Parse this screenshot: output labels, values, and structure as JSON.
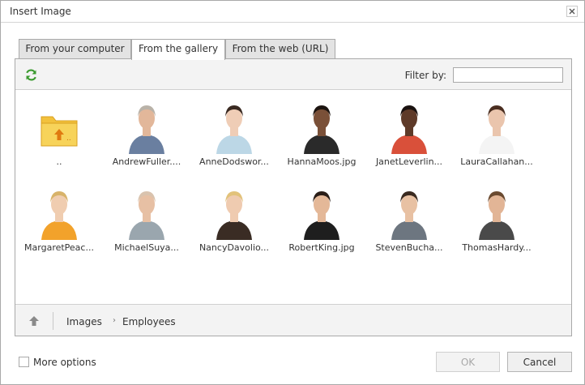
{
  "dialog": {
    "title": "Insert Image",
    "close_icon": "close-icon"
  },
  "tabs": [
    {
      "label": "From your computer",
      "active": false
    },
    {
      "label": "From the gallery",
      "active": true
    },
    {
      "label": "From the web (URL)",
      "active": false
    }
  ],
  "toolbar": {
    "refresh_icon": "refresh-icon",
    "filter_label": "Filter by:",
    "filter_value": ""
  },
  "gallery": {
    "items": [
      {
        "name": "..",
        "type": "folder-up"
      },
      {
        "name": "AndrewFuller....",
        "type": "image",
        "shirt": "#6a7fa0",
        "skin": "#e2b79a",
        "hair": "#b9b2a8"
      },
      {
        "name": "AnneDodswor...",
        "type": "image",
        "shirt": "#bcd7e6",
        "skin": "#efcdb6",
        "hair": "#3a2a22"
      },
      {
        "name": "HannaMoos.jpg",
        "type": "image",
        "shirt": "#2a2a2a",
        "skin": "#7a5038",
        "hair": "#1c1410"
      },
      {
        "name": "JanetLeverlin...",
        "type": "image",
        "shirt": "#d9503a",
        "skin": "#5e3a28",
        "hair": "#1a1210"
      },
      {
        "name": "LauraCallahan...",
        "type": "image",
        "shirt": "#f4f4f4",
        "skin": "#eac5ad",
        "hair": "#4a2e20"
      },
      {
        "name": "MargaretPeac...",
        "type": "image",
        "shirt": "#f2a22b",
        "skin": "#f0cdb0",
        "hair": "#d8b36a"
      },
      {
        "name": "MichaelSuya...",
        "type": "image",
        "shirt": "#9aa6ae",
        "skin": "#e7c0a4",
        "hair": "#d9c3ae"
      },
      {
        "name": "NancyDavolio...",
        "type": "image",
        "shirt": "#3a2c24",
        "skin": "#efcbb0",
        "hair": "#e2c27a"
      },
      {
        "name": "RobertKing.jpg",
        "type": "image",
        "shirt": "#1e1e1e",
        "skin": "#e4b898",
        "hair": "#2a1e18"
      },
      {
        "name": "StevenBucha...",
        "type": "image",
        "shirt": "#6d7680",
        "skin": "#e8c1a3",
        "hair": "#3a2a20"
      },
      {
        "name": "ThomasHardy...",
        "type": "image",
        "shirt": "#4a4a4a",
        "skin": "#e2b596",
        "hair": "#6a4a30"
      }
    ]
  },
  "pathbar": {
    "up_icon": "up-arrow-icon",
    "crumbs": [
      "Images",
      "Employees"
    ],
    "separator": "›"
  },
  "footer": {
    "more_options_label": "More options",
    "more_options_checked": false,
    "ok_label": "OK",
    "ok_disabled": true,
    "cancel_label": "Cancel"
  }
}
